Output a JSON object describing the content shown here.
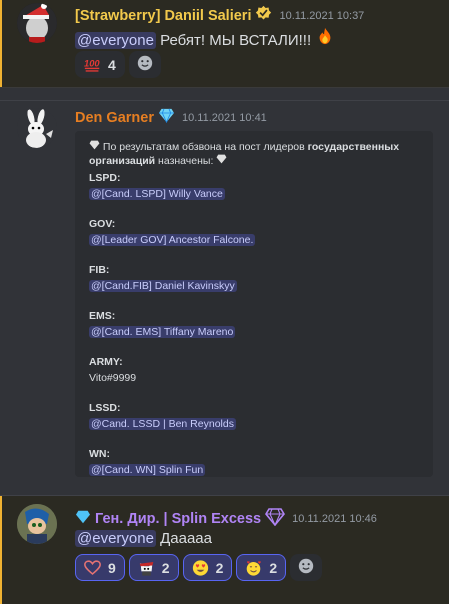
{
  "messages": [
    {
      "author": "[Strawberry] Daniil Salieri",
      "timestamp": "10.11.2021 10:37",
      "mention": "@everyone",
      "text": "Ребят! МЫ ВСТАЛИ!!!",
      "reactions": [
        {
          "emoji": "100-icon",
          "count": "4"
        }
      ]
    },
    {
      "author": "Den Garner",
      "timestamp": "10.11.2021 10:41",
      "embed": {
        "intro_a": "По результатам обзвона на пост лидеров ",
        "intro_b": "государственных",
        "intro_c": "организаций",
        "intro_d": " назначены:",
        "sections": [
          {
            "label": "LSPD:",
            "value": "@[Cand. LSPD] Willy Vance"
          },
          {
            "label": "GOV:",
            "value": "@[Leader GOV] Ancestor Falcone."
          },
          {
            "label": "FIB:",
            "value": "@[Cand.FIB] Daniel Kavinskyy"
          },
          {
            "label": "EMS:",
            "value": "@[Cand. EMS] Tiffany Mareno"
          },
          {
            "label": "ARMY:",
            "value": "Vito#9999"
          },
          {
            "label": "LSSD:",
            "value": "@Cand. LSSD | Ben Reynolds"
          },
          {
            "label": "WN:",
            "value": "@[Cand. WN] Splin Fun"
          }
        ]
      }
    },
    {
      "author": "Ген. Дир. | Splin Excess",
      "timestamp": "10.11.2021 10:46",
      "mention": "@everyone",
      "text": "Дааааа",
      "reactions": [
        {
          "emoji": "heart-outline-icon",
          "count": "9"
        },
        {
          "emoji": "pirate-cat-icon",
          "count": "2"
        },
        {
          "emoji": "heart-eyes-icon",
          "count": "2"
        },
        {
          "emoji": "smiling-hearts-icon",
          "count": "2"
        }
      ]
    }
  ],
  "colors": {
    "gold": "#f2c94c",
    "orange": "#e67e22",
    "purple": "#b084f5",
    "mention_bg": "#414475"
  }
}
